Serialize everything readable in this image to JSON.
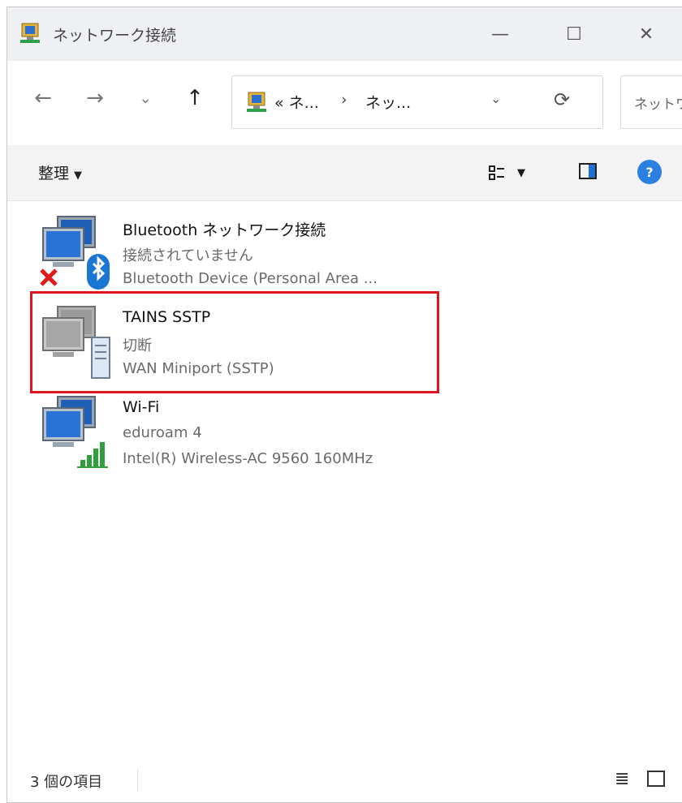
{
  "window": {
    "title": "ネットワーク接続",
    "controls": {
      "minimize": "—",
      "maximize": "☐",
      "close": "✕"
    }
  },
  "nav": {
    "back": "←",
    "forward": "→",
    "history": "⌄",
    "up": "↑",
    "breadcrumb": [
      "« ネ...",
      "›",
      "ネッ..."
    ],
    "address_dropdown": "⌄",
    "refresh": "⟳",
    "search_text": "ネットワ"
  },
  "commandbar": {
    "organize_label": "整理",
    "organize_caret": "▼",
    "view_caret": "▼",
    "help_label": "?"
  },
  "items": [
    {
      "name": "Bluetooth ネットワーク接続",
      "status": "接続されていません",
      "device": "Bluetooth Device (Personal Area ...",
      "icon": "bluetooth-network-icon"
    },
    {
      "name": "TAINS SSTP",
      "status": "切断",
      "device": "WAN Miniport (SSTP)",
      "icon": "vpn-network-icon",
      "highlighted": true,
      "highlight_color": "#e0141e"
    },
    {
      "name": "Wi-Fi",
      "status": "eduroam 4",
      "device": "Intel(R) Wireless-AC 9560 160MHz",
      "icon": "wifi-network-icon"
    }
  ],
  "statusbar": {
    "count": "3 個の項目"
  },
  "colors": {
    "accent": "#2a7fe0",
    "highlight": "#e0141e",
    "title_bg": "#eef0f4"
  }
}
